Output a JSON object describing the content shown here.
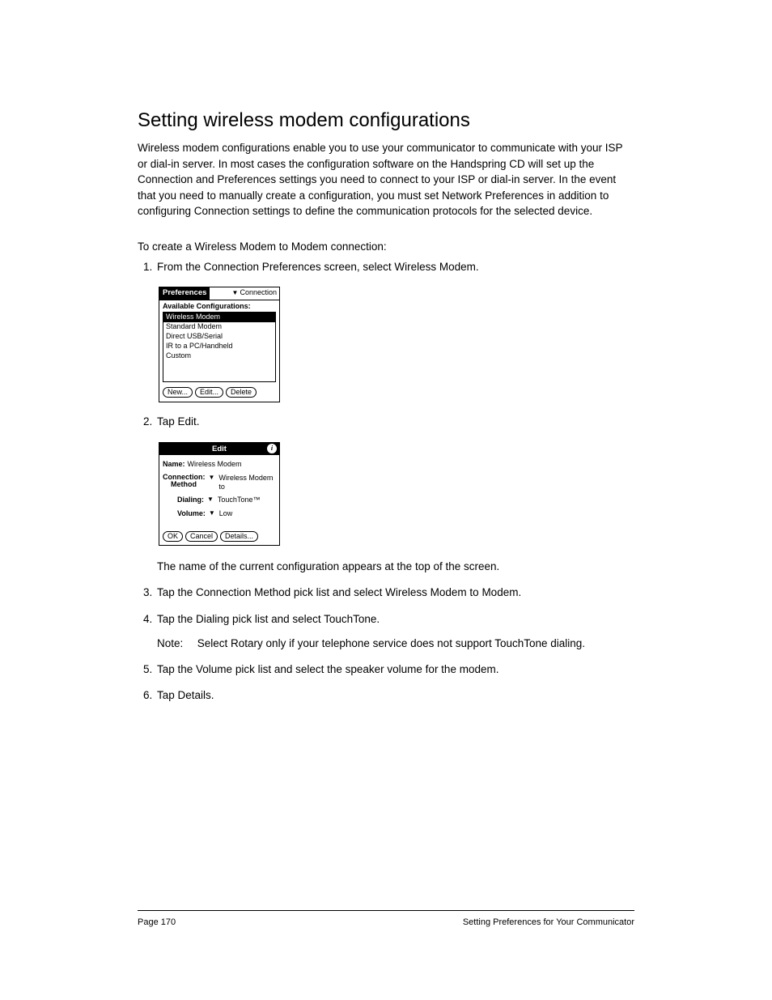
{
  "heading": "Setting wireless modem configurations",
  "intro": "Wireless modem configurations enable you to use your communicator to communicate with your ISP or dial-in server. In most cases the configuration software on the Handspring CD will set up the Connection and Preferences settings you need to connect to your ISP or dial-in server. In the event that you need to manually create a configuration, you must set Network Preferences in addition to configuring Connection settings to define the communication protocols for the selected device.",
  "subhead": "To create a Wireless Modem to Modem connection:",
  "steps": {
    "s1": "From the Connection Preferences screen, select Wireless Modem.",
    "s2": "Tap Edit.",
    "s2_after": "The name of the current configuration appears at the top of the screen.",
    "s3": "Tap the Connection Method pick list and select Wireless Modem to Modem.",
    "s4": "Tap the Dialing pick list and select TouchTone.",
    "s4_note_label": "Note:",
    "s4_note": "Select Rotary only if your telephone service does not support TouchTone dialing.",
    "s5": "Tap the Volume pick list and select the speaker volume for the modem.",
    "s6": "Tap Details."
  },
  "mock1": {
    "title_left": "Preferences",
    "title_right": "Connection",
    "section_label": "Available Configurations:",
    "items": [
      "Wireless Modem",
      "Standard Modem",
      "Direct USB/Serial",
      "IR to a PC/Handheld",
      "Custom"
    ],
    "buttons": [
      "New...",
      "Edit...",
      "Delete"
    ]
  },
  "mock2": {
    "title": "Edit",
    "name_label": "Name:",
    "name_value": "Wireless Modem",
    "conn_label1": "Connection:",
    "conn_label2": "Method",
    "conn_value": "Wireless Modem to",
    "dial_label": "Dialing:",
    "dial_value": "TouchTone™",
    "vol_label": "Volume:",
    "vol_value": "Low",
    "buttons": [
      "OK",
      "Cancel",
      "Details..."
    ]
  },
  "footer": {
    "left": "Page 170",
    "right": "Setting Preferences for Your Communicator"
  }
}
